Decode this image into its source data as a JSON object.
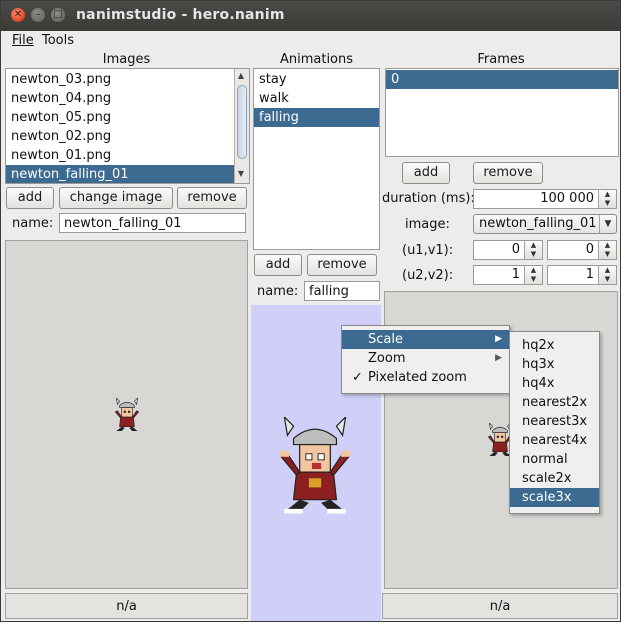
{
  "window": {
    "title": "nanimstudio - hero.nanim"
  },
  "menubar": {
    "file": "File",
    "tools": "Tools"
  },
  "images": {
    "header": "Images",
    "items": [
      "newton_03.png",
      "newton_04.png",
      "newton_05.png",
      "newton_02.png",
      "newton_01.png",
      "newton_falling_01"
    ],
    "selected_index": 5,
    "add_label": "add",
    "change_label": "change image",
    "remove_label": "remove",
    "name_label": "name:",
    "name_value": "newton_falling_01",
    "status": "n/a"
  },
  "animations": {
    "header": "Animations",
    "items": [
      "stay",
      "walk",
      "falling"
    ],
    "selected_index": 2,
    "add_label": "add",
    "remove_label": "remove",
    "name_label": "name:",
    "name_value": "falling"
  },
  "frames": {
    "header": "Frames",
    "items": [
      "0"
    ],
    "selected_index": 0,
    "add_label": "add",
    "remove_label": "remove",
    "duration_label": "duration (ms):",
    "duration_value": "100 000",
    "image_label": "image:",
    "image_value": "newton_falling_01",
    "uv1_label": "(u1,v1):",
    "u1": "0",
    "v1": "0",
    "uv2_label": "(u2,v2):",
    "u2": "1",
    "v2": "1",
    "status": "n/a"
  },
  "context_menu": {
    "items": [
      {
        "label": "Scale",
        "check": "",
        "submenu": true
      },
      {
        "label": "Zoom",
        "check": "",
        "submenu": true
      },
      {
        "label": "Pixelated zoom",
        "check": "✓",
        "submenu": false
      }
    ],
    "highlighted_index": 0
  },
  "scale_submenu": {
    "items": [
      "hq2x",
      "hq3x",
      "hq4x",
      "nearest2x",
      "nearest3x",
      "nearest4x",
      "normal",
      "scale2x",
      "scale3x"
    ],
    "highlighted_index": 8
  },
  "colors": {
    "selection": "#3c6a90",
    "animation_preview_bg": "#cfcff7",
    "titlebar": "#3c3b37"
  },
  "icons": {
    "close": "close-icon",
    "minimize": "minimize-icon",
    "maximize": "maximize-icon",
    "submenu": "chevron-right-icon",
    "spin_up": "arrow-up-icon",
    "spin_down": "arrow-down-icon",
    "combo": "chevron-down-icon",
    "sprite": "viking-sprite"
  }
}
